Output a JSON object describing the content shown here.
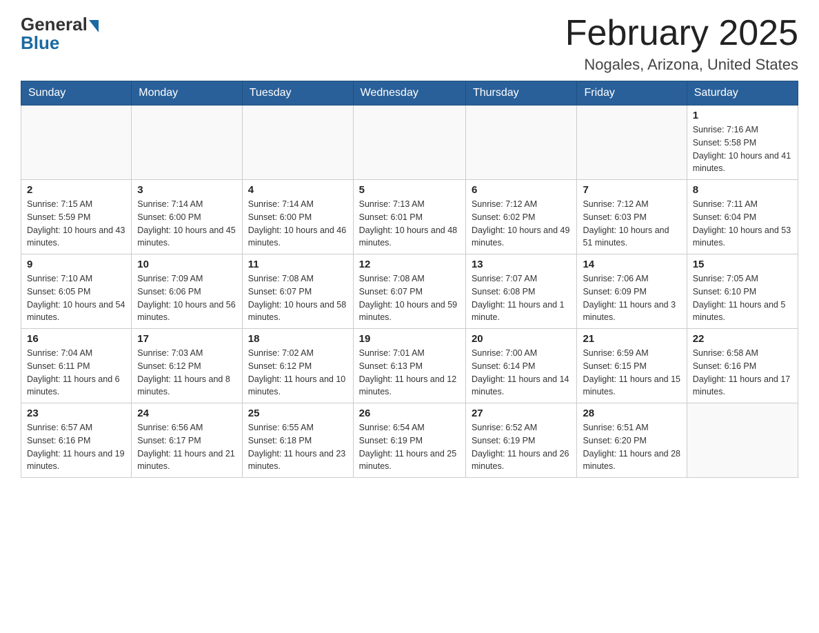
{
  "header": {
    "logo_general": "General",
    "logo_blue": "Blue",
    "month_title": "February 2025",
    "location": "Nogales, Arizona, United States"
  },
  "days_of_week": [
    "Sunday",
    "Monday",
    "Tuesday",
    "Wednesday",
    "Thursday",
    "Friday",
    "Saturday"
  ],
  "weeks": [
    [
      {
        "day": "",
        "info": ""
      },
      {
        "day": "",
        "info": ""
      },
      {
        "day": "",
        "info": ""
      },
      {
        "day": "",
        "info": ""
      },
      {
        "day": "",
        "info": ""
      },
      {
        "day": "",
        "info": ""
      },
      {
        "day": "1",
        "info": "Sunrise: 7:16 AM\nSunset: 5:58 PM\nDaylight: 10 hours and 41 minutes."
      }
    ],
    [
      {
        "day": "2",
        "info": "Sunrise: 7:15 AM\nSunset: 5:59 PM\nDaylight: 10 hours and 43 minutes."
      },
      {
        "day": "3",
        "info": "Sunrise: 7:14 AM\nSunset: 6:00 PM\nDaylight: 10 hours and 45 minutes."
      },
      {
        "day": "4",
        "info": "Sunrise: 7:14 AM\nSunset: 6:00 PM\nDaylight: 10 hours and 46 minutes."
      },
      {
        "day": "5",
        "info": "Sunrise: 7:13 AM\nSunset: 6:01 PM\nDaylight: 10 hours and 48 minutes."
      },
      {
        "day": "6",
        "info": "Sunrise: 7:12 AM\nSunset: 6:02 PM\nDaylight: 10 hours and 49 minutes."
      },
      {
        "day": "7",
        "info": "Sunrise: 7:12 AM\nSunset: 6:03 PM\nDaylight: 10 hours and 51 minutes."
      },
      {
        "day": "8",
        "info": "Sunrise: 7:11 AM\nSunset: 6:04 PM\nDaylight: 10 hours and 53 minutes."
      }
    ],
    [
      {
        "day": "9",
        "info": "Sunrise: 7:10 AM\nSunset: 6:05 PM\nDaylight: 10 hours and 54 minutes."
      },
      {
        "day": "10",
        "info": "Sunrise: 7:09 AM\nSunset: 6:06 PM\nDaylight: 10 hours and 56 minutes."
      },
      {
        "day": "11",
        "info": "Sunrise: 7:08 AM\nSunset: 6:07 PM\nDaylight: 10 hours and 58 minutes."
      },
      {
        "day": "12",
        "info": "Sunrise: 7:08 AM\nSunset: 6:07 PM\nDaylight: 10 hours and 59 minutes."
      },
      {
        "day": "13",
        "info": "Sunrise: 7:07 AM\nSunset: 6:08 PM\nDaylight: 11 hours and 1 minute."
      },
      {
        "day": "14",
        "info": "Sunrise: 7:06 AM\nSunset: 6:09 PM\nDaylight: 11 hours and 3 minutes."
      },
      {
        "day": "15",
        "info": "Sunrise: 7:05 AM\nSunset: 6:10 PM\nDaylight: 11 hours and 5 minutes."
      }
    ],
    [
      {
        "day": "16",
        "info": "Sunrise: 7:04 AM\nSunset: 6:11 PM\nDaylight: 11 hours and 6 minutes."
      },
      {
        "day": "17",
        "info": "Sunrise: 7:03 AM\nSunset: 6:12 PM\nDaylight: 11 hours and 8 minutes."
      },
      {
        "day": "18",
        "info": "Sunrise: 7:02 AM\nSunset: 6:12 PM\nDaylight: 11 hours and 10 minutes."
      },
      {
        "day": "19",
        "info": "Sunrise: 7:01 AM\nSunset: 6:13 PM\nDaylight: 11 hours and 12 minutes."
      },
      {
        "day": "20",
        "info": "Sunrise: 7:00 AM\nSunset: 6:14 PM\nDaylight: 11 hours and 14 minutes."
      },
      {
        "day": "21",
        "info": "Sunrise: 6:59 AM\nSunset: 6:15 PM\nDaylight: 11 hours and 15 minutes."
      },
      {
        "day": "22",
        "info": "Sunrise: 6:58 AM\nSunset: 6:16 PM\nDaylight: 11 hours and 17 minutes."
      }
    ],
    [
      {
        "day": "23",
        "info": "Sunrise: 6:57 AM\nSunset: 6:16 PM\nDaylight: 11 hours and 19 minutes."
      },
      {
        "day": "24",
        "info": "Sunrise: 6:56 AM\nSunset: 6:17 PM\nDaylight: 11 hours and 21 minutes."
      },
      {
        "day": "25",
        "info": "Sunrise: 6:55 AM\nSunset: 6:18 PM\nDaylight: 11 hours and 23 minutes."
      },
      {
        "day": "26",
        "info": "Sunrise: 6:54 AM\nSunset: 6:19 PM\nDaylight: 11 hours and 25 minutes."
      },
      {
        "day": "27",
        "info": "Sunrise: 6:52 AM\nSunset: 6:19 PM\nDaylight: 11 hours and 26 minutes."
      },
      {
        "day": "28",
        "info": "Sunrise: 6:51 AM\nSunset: 6:20 PM\nDaylight: 11 hours and 28 minutes."
      },
      {
        "day": "",
        "info": ""
      }
    ]
  ]
}
